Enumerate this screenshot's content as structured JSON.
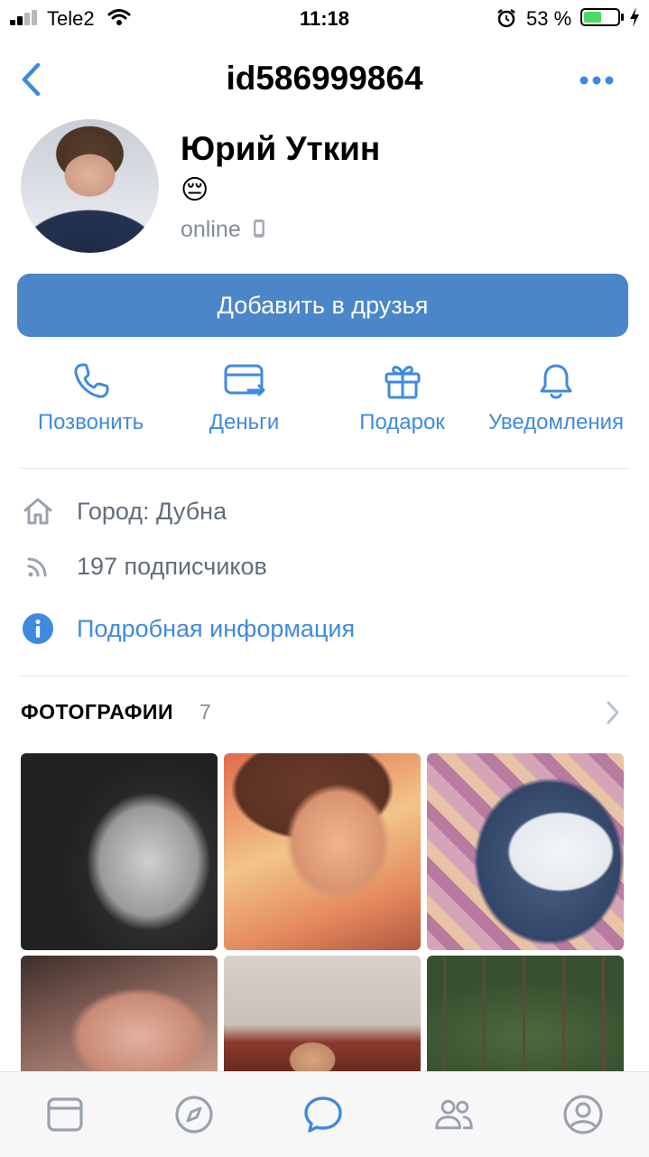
{
  "status_bar": {
    "carrier": "Tele2",
    "time": "11:18",
    "battery_percent": "53 %",
    "battery_level": 0.53
  },
  "nav": {
    "title": "id586999864",
    "back_icon": "chevron-left-icon",
    "more_icon": "more-horizontal-icon"
  },
  "profile": {
    "name": "Юрий Уткин",
    "status_emoji": "😔",
    "online": "online",
    "online_device_icon": "phone-icon"
  },
  "add_friend_button": "Добавить в друзья",
  "actions": [
    {
      "label": "Позвонить",
      "icon": "phone-call-icon"
    },
    {
      "label": "Деньги",
      "icon": "money-transfer-icon"
    },
    {
      "label": "Подарок",
      "icon": "gift-icon"
    },
    {
      "label": "Уведомления",
      "icon": "bell-icon"
    }
  ],
  "info": {
    "city": "Город: Дубна",
    "followers": "197 подписчиков",
    "details_link": "Подробная информация"
  },
  "photos": {
    "title": "ФОТОГРАФИИ",
    "count": "7"
  },
  "tabbar": {
    "items": [
      "newsfeed-icon",
      "discover-icon",
      "messages-icon",
      "friends-icon",
      "profile-icon"
    ],
    "active_color": "#3f8ae0",
    "inactive_color": "#99a2ad"
  },
  "colors": {
    "accent": "#3f8ae0",
    "button": "#4b86c8",
    "battery": "#4cd964"
  }
}
